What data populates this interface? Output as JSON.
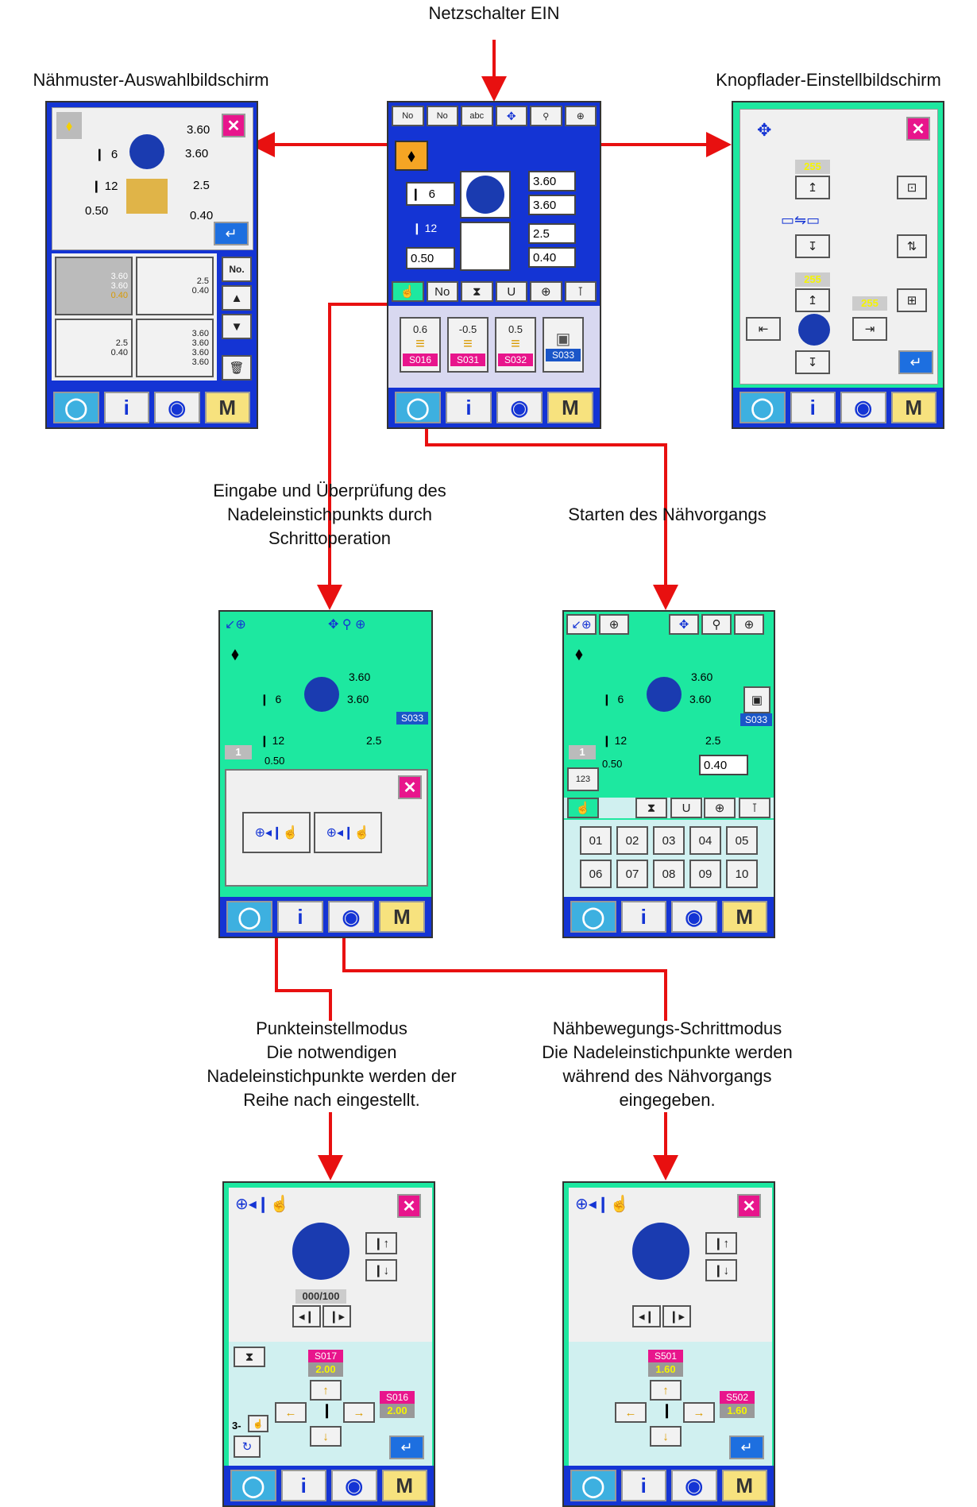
{
  "labels": {
    "power_on": "Netzschalter EIN",
    "pattern_select": "Nähmuster-Auswahlbildschirm",
    "loader_adjust": "Knopflader-Einstellbildschirm",
    "input_check": "Eingabe und Überprüfung des\nNadeleinstichpunkts durch\nSchrittoperation",
    "start_sewing": "Starten des Nähvorgangs",
    "point_mode": "Punkteinstellmodus\nDie notwendigen\nNadeleinstichpunkte werden der\nReihe nach eingestellt.",
    "step_mode": "Nähbewegungs-Schrittmodus\nDie Nadeleinstichpunkte werden\nwährend des Nähvorgangs\neingegeben."
  },
  "colors": {
    "arrow": "#e81010",
    "blue": "#1434d4",
    "green": "#1de8a0",
    "pink": "#e8158c"
  },
  "screens": {
    "main": {
      "values": {
        "stitch_count": "6",
        "width1": "3.60",
        "width2": "3.60",
        "needle_count": "12",
        "feed": "0.50",
        "height": "2.5",
        "offset": "0.40"
      },
      "icon_buttons": [
        {
          "value": "0.6",
          "tag": "S016"
        },
        {
          "value": "-0.5",
          "tag": "S031"
        },
        {
          "value": "0.5",
          "tag": "S032"
        },
        {
          "value": "",
          "tag": "S033"
        }
      ]
    },
    "pattern": {
      "values": {
        "width1": "3.60",
        "stitch_count": "6",
        "width2": "3.60",
        "needle_count": "12",
        "height": "2.5",
        "feed": "0.50",
        "offset": "0.40"
      },
      "list_values": {
        "p1_w1": "3.60",
        "p1_w2": "3.60",
        "p1_off": "0.40",
        "p2_h": "2.5",
        "p2_off": "0.40",
        "p3_h": "2.5",
        "p3_off": "0.40",
        "p4_w1": "3.60",
        "p4_w2": "3.60",
        "p4_w3": "3.60",
        "p4_w4": "3.60"
      },
      "no_label": "No."
    },
    "loader": {
      "values": {
        "v1": "255",
        "v2": "255",
        "v3": "255"
      }
    },
    "stepcheck": {
      "values": {
        "width1": "3.60",
        "stitch_count": "6",
        "width2": "3.60",
        "needle_count": "12",
        "height": "2.5",
        "feed": "0.50",
        "step": "1",
        "tag": "S033"
      }
    },
    "sewing": {
      "values": {
        "width1": "3.60",
        "stitch_count": "6",
        "width2": "3.60",
        "needle_count": "12",
        "height": "2.5",
        "feed": "0.50",
        "offset": "0.40",
        "step": "1",
        "tag": "S033"
      },
      "patterns": [
        "01",
        "02",
        "03",
        "04",
        "05",
        "06",
        "07",
        "08",
        "09",
        "10"
      ]
    },
    "point": {
      "counter": "000/100",
      "tag_a": "S017",
      "val_a": "2.00",
      "tag_b": "S016",
      "val_b": "2.00",
      "step_prefix": "3-"
    },
    "stepmode": {
      "tag_a": "S501",
      "val_a": "1.60",
      "tag_b": "S502",
      "val_b": "1.60"
    }
  },
  "bottom_bar": {
    "info": "i",
    "mode": "M"
  }
}
